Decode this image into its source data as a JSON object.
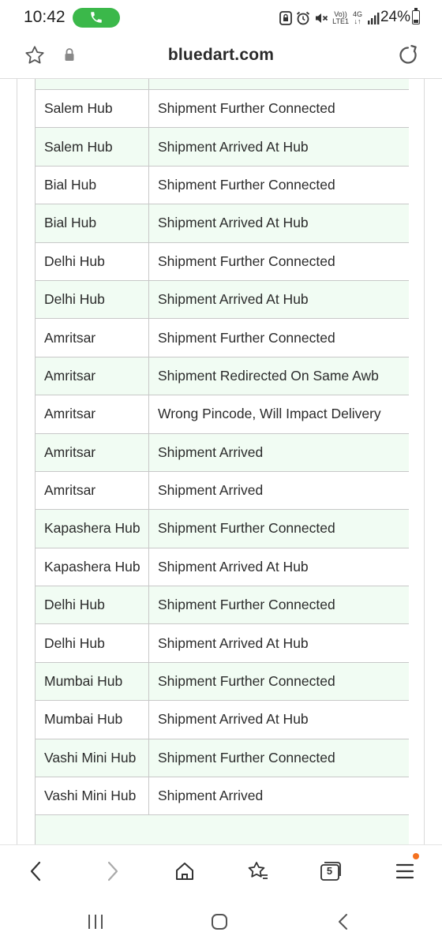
{
  "status_bar": {
    "time": "10:42",
    "battery": "24%",
    "network_top": "4G",
    "network_bottom": "LTE1",
    "icons": [
      "call-icon",
      "lock-notification-icon",
      "alarm-icon",
      "mute-icon",
      "volte-icon",
      "signal-icon",
      "battery-icon"
    ]
  },
  "address_bar": {
    "url": "bluedart.com",
    "icons": [
      "bookmark-star-icon",
      "lock-icon",
      "reload-icon"
    ]
  },
  "tracking_table": {
    "rows": [
      {
        "location": "Salem Hub",
        "activity": "Shipment Further Connected"
      },
      {
        "location": "Salem Hub",
        "activity": "Shipment Arrived At Hub"
      },
      {
        "location": "Bial Hub",
        "activity": "Shipment Further Connected"
      },
      {
        "location": "Bial Hub",
        "activity": "Shipment Arrived At Hub"
      },
      {
        "location": "Delhi Hub",
        "activity": "Shipment Further Connected"
      },
      {
        "location": "Delhi Hub",
        "activity": "Shipment Arrived At Hub"
      },
      {
        "location": "Amritsar",
        "activity": "Shipment Further Connected"
      },
      {
        "location": "Amritsar",
        "activity": "Shipment Redirected On Same Awb"
      },
      {
        "location": "Amritsar",
        "activity": "Wrong Pincode, Will Impact Delivery"
      },
      {
        "location": "Amritsar",
        "activity": "Shipment Arrived"
      },
      {
        "location": "Amritsar",
        "activity": "Shipment Arrived"
      },
      {
        "location": "Kapashera Hub",
        "activity": "Shipment Further Connected"
      },
      {
        "location": "Kapashera Hub",
        "activity": "Shipment Arrived At Hub"
      },
      {
        "location": "Delhi Hub",
        "activity": "Shipment Further Connected"
      },
      {
        "location": "Delhi Hub",
        "activity": "Shipment Arrived At Hub"
      },
      {
        "location": "Mumbai Hub",
        "activity": "Shipment Further Connected"
      },
      {
        "location": "Mumbai Hub",
        "activity": "Shipment Arrived At Hub"
      },
      {
        "location": "Vashi Mini Hub",
        "activity": "Shipment Further Connected"
      },
      {
        "location": "Vashi Mini Hub",
        "activity": "Shipment Arrived"
      }
    ]
  },
  "browser_toolbar": {
    "tab_count": "5",
    "icons": [
      "back-icon",
      "forward-icon",
      "home-icon",
      "bookmarks-icon",
      "tabs-icon",
      "menu-icon"
    ]
  },
  "system_nav": {
    "icons": [
      "recents-icon",
      "home-nav-icon",
      "back-nav-icon"
    ]
  },
  "colors": {
    "row_alt": "#f1fcf3",
    "grid": "#c8c8c8",
    "call_green": "#3bb84a",
    "notification_dot": "#f4711f"
  }
}
